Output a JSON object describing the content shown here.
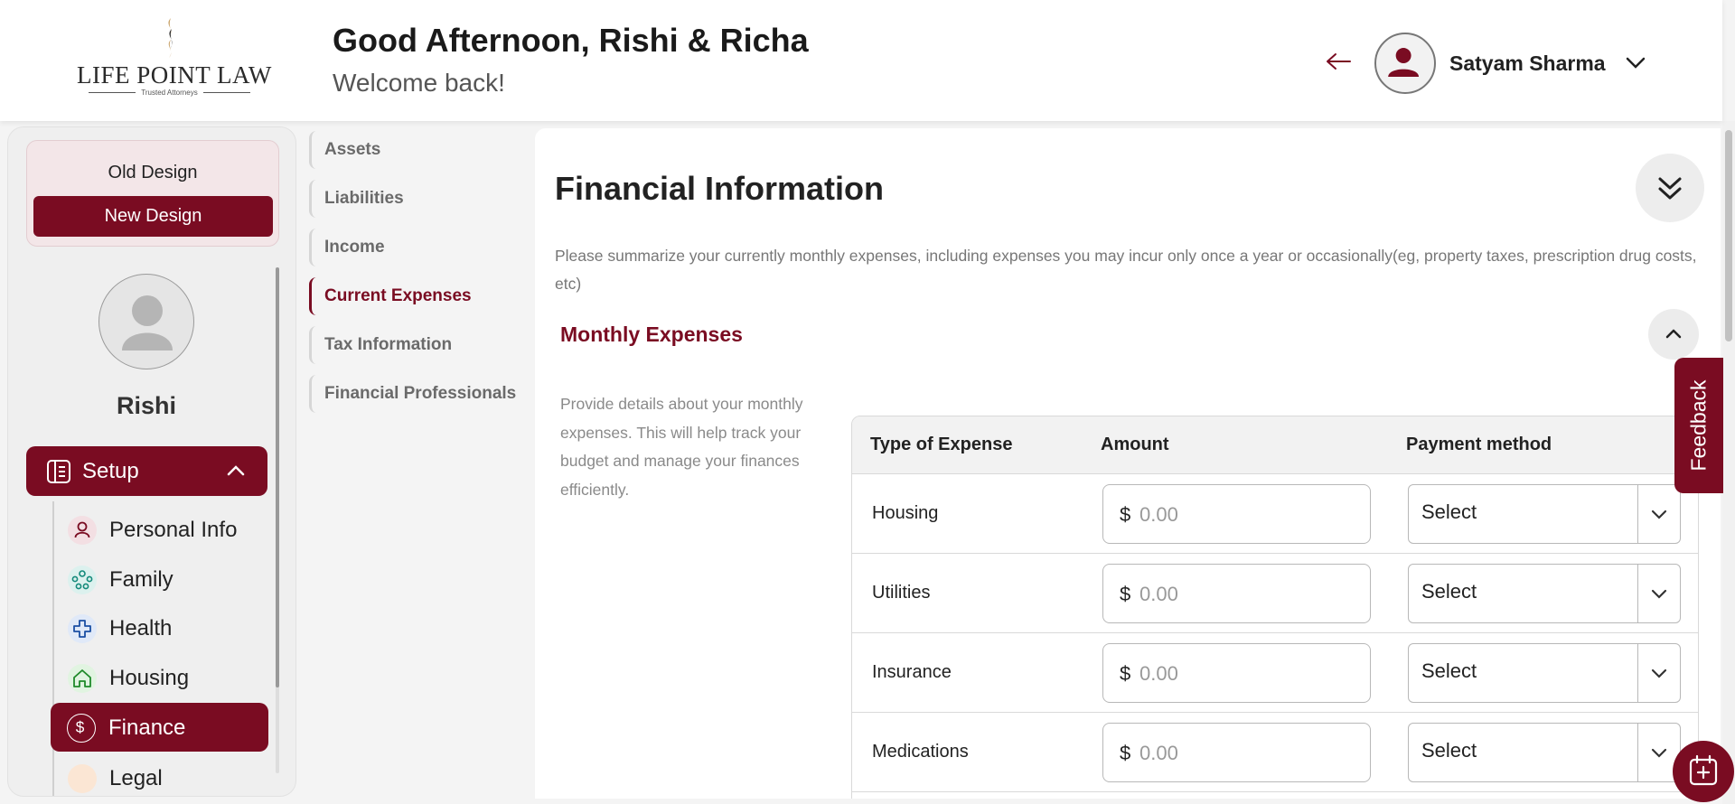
{
  "colors": {
    "brand": "#7a0c22",
    "background": "#f4f4f4"
  },
  "logo": {
    "text": "LIFE POINT LAW",
    "subtext": "Trusted Attorneys"
  },
  "header": {
    "greeting": "Good Afternoon, Rishi & Richa",
    "welcome": "Welcome back!",
    "back_icon": "arrow-left-icon",
    "user_name": "Satyam Sharma"
  },
  "sidebar": {
    "old_design": "Old Design",
    "new_design": "New Design",
    "profile_name": "Rishi",
    "setup_label": "Setup",
    "items": [
      {
        "label": "Personal Info",
        "icon": "person-icon"
      },
      {
        "label": "Family",
        "icon": "family-icon"
      },
      {
        "label": "Health",
        "icon": "health-cross-icon"
      },
      {
        "label": "Housing",
        "icon": "house-icon"
      },
      {
        "label": "Finance",
        "icon": "dollar-icon",
        "active": true
      },
      {
        "label": "Legal",
        "icon": "legal-icon"
      }
    ]
  },
  "subnav": {
    "items": [
      {
        "label": "Assets"
      },
      {
        "label": "Liabilities"
      },
      {
        "label": "Income"
      },
      {
        "label": "Current Expenses",
        "active": true
      },
      {
        "label": "Tax Information"
      },
      {
        "label": "Financial Professionals"
      }
    ]
  },
  "main": {
    "title": "Financial Information",
    "intro": "Please summarize your currently monthly expenses, including expenses you may incur only once a year or occasionally(eg, property taxes, prescription drug costs, etc)",
    "section_title": "Monthly Expenses",
    "section_desc": "Provide details about your monthly expenses. This will help track your budget and manage your finances efficiently.",
    "table": {
      "headers": [
        "Type of Expense",
        "Amount",
        "Payment method"
      ],
      "currency": "$",
      "rows": [
        {
          "type": "Housing",
          "amount_placeholder": "0.00",
          "payment": "Select"
        },
        {
          "type": "Utilities",
          "amount_placeholder": "0.00",
          "payment": "Select"
        },
        {
          "type": "Insurance",
          "amount_placeholder": "0.00",
          "payment": "Select"
        },
        {
          "type": "Medications",
          "amount_placeholder": "0.00",
          "payment": "Select"
        }
      ]
    }
  },
  "feedback": "Feedback"
}
